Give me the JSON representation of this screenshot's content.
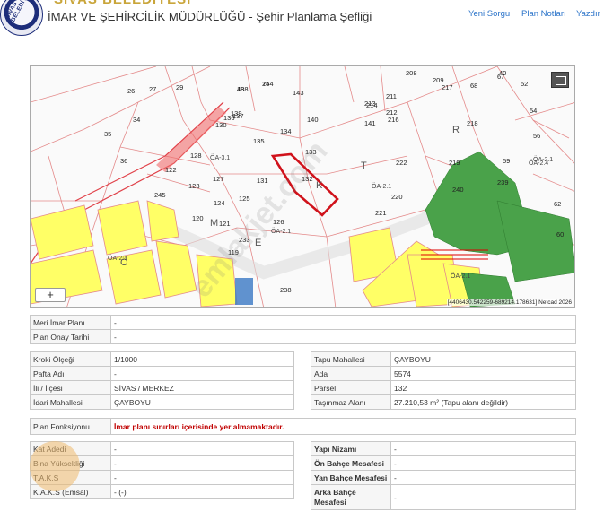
{
  "header": {
    "banner": "SİVAS BELEDİYESİ",
    "logo_text": "SİVAS BELEDİYE",
    "title": "İMAR VE ŞEHİRCİLİK MÜDÜRLÜĞÜ - Şehir Planlama Şefliği",
    "nav": [
      "Yeni Sorgu",
      "Plan Notları",
      "Yazdır"
    ],
    "colors": {
      "nav_link": "#2a73c9",
      "logo_blue": "#1d2d7a"
    }
  },
  "map": {
    "zoom_label": "+",
    "coordinates": "[4406430.542259-689214.178631] Netcad 2026",
    "parcel_labels": [
      "138",
      "144",
      "143",
      "139",
      "137",
      "132",
      "131",
      "133",
      "134",
      "135",
      "140",
      "141",
      "127",
      "128",
      "122",
      "123",
      "124",
      "125",
      "126",
      "120",
      "121",
      "245",
      "233",
      "238",
      "119",
      "130",
      "136",
      "35",
      "34",
      "36",
      "27",
      "29",
      "26",
      "208",
      "209",
      "211",
      "212",
      "213",
      "214",
      "216",
      "217",
      "218",
      "219",
      "220",
      "221",
      "222",
      "239",
      "240",
      "40",
      "54",
      "56",
      "59",
      "60",
      "62",
      "67",
      "68",
      "52",
      "48",
      "25"
    ],
    "zone_labels": [
      "ÖA-2.1",
      "ÖA-2.1",
      "ÖA-2.1",
      "ÖA-2.4",
      "ÖA-2.1",
      "ÖA-2.1",
      "ÖA-3.1"
    ],
    "road_letters": [
      "K",
      "T",
      "R",
      "M",
      "E",
      "Ö"
    ],
    "colors": {
      "residential_yellow": "#ffff66",
      "green_zone": "#4aa24a",
      "highlight_parcel": "#d0121b",
      "road_red": "#e0474c"
    }
  },
  "plan_info": {
    "rows": [
      {
        "label": "Meri İmar Planı",
        "value": "-"
      },
      {
        "label": "Plan Onay Tarihi",
        "value": "-"
      }
    ]
  },
  "parcel_left": {
    "rows": [
      {
        "label": "Kroki Ölçeği",
        "value": "1/1000"
      },
      {
        "label": "Pafta Adı",
        "value": "-"
      },
      {
        "label": "İli / İlçesi",
        "value": "SİVAS / MERKEZ"
      },
      {
        "label": "İdari Mahallesi",
        "value": "ÇAYBOYU"
      }
    ]
  },
  "parcel_right": {
    "rows": [
      {
        "label": "Tapu Mahallesi",
        "value": "ÇAYBOYU"
      },
      {
        "label": "Ada",
        "value": "5574"
      },
      {
        "label": "Parsel",
        "value": "132"
      },
      {
        "label": "Taşınmaz Alanı",
        "value": "27.210,53 m² (Tapu alanı değildir)"
      }
    ]
  },
  "plan_function": {
    "label": "Plan Fonksiyonu",
    "value": "İmar planı sınırları içerisinde yer almamaktadır."
  },
  "build_left": {
    "rows": [
      {
        "label": "Kat Adedi",
        "value": "-"
      },
      {
        "label": "Bina Yüksekliği",
        "value": "-"
      },
      {
        "label": "T.A.K.S",
        "value": "-"
      },
      {
        "label": "K.A.K.S (Emsal)",
        "value": "- (-)"
      }
    ]
  },
  "build_right": {
    "rows": [
      {
        "label": "Yapı Nizamı",
        "value": "-"
      },
      {
        "label": "Ön Bahçe Mesafesi",
        "value": "-"
      },
      {
        "label": "Yan Bahçe Mesafesi",
        "value": "-"
      },
      {
        "label": "Arka Bahçe Mesafesi",
        "value": "-"
      }
    ]
  },
  "watermark": "emlakjet.com"
}
